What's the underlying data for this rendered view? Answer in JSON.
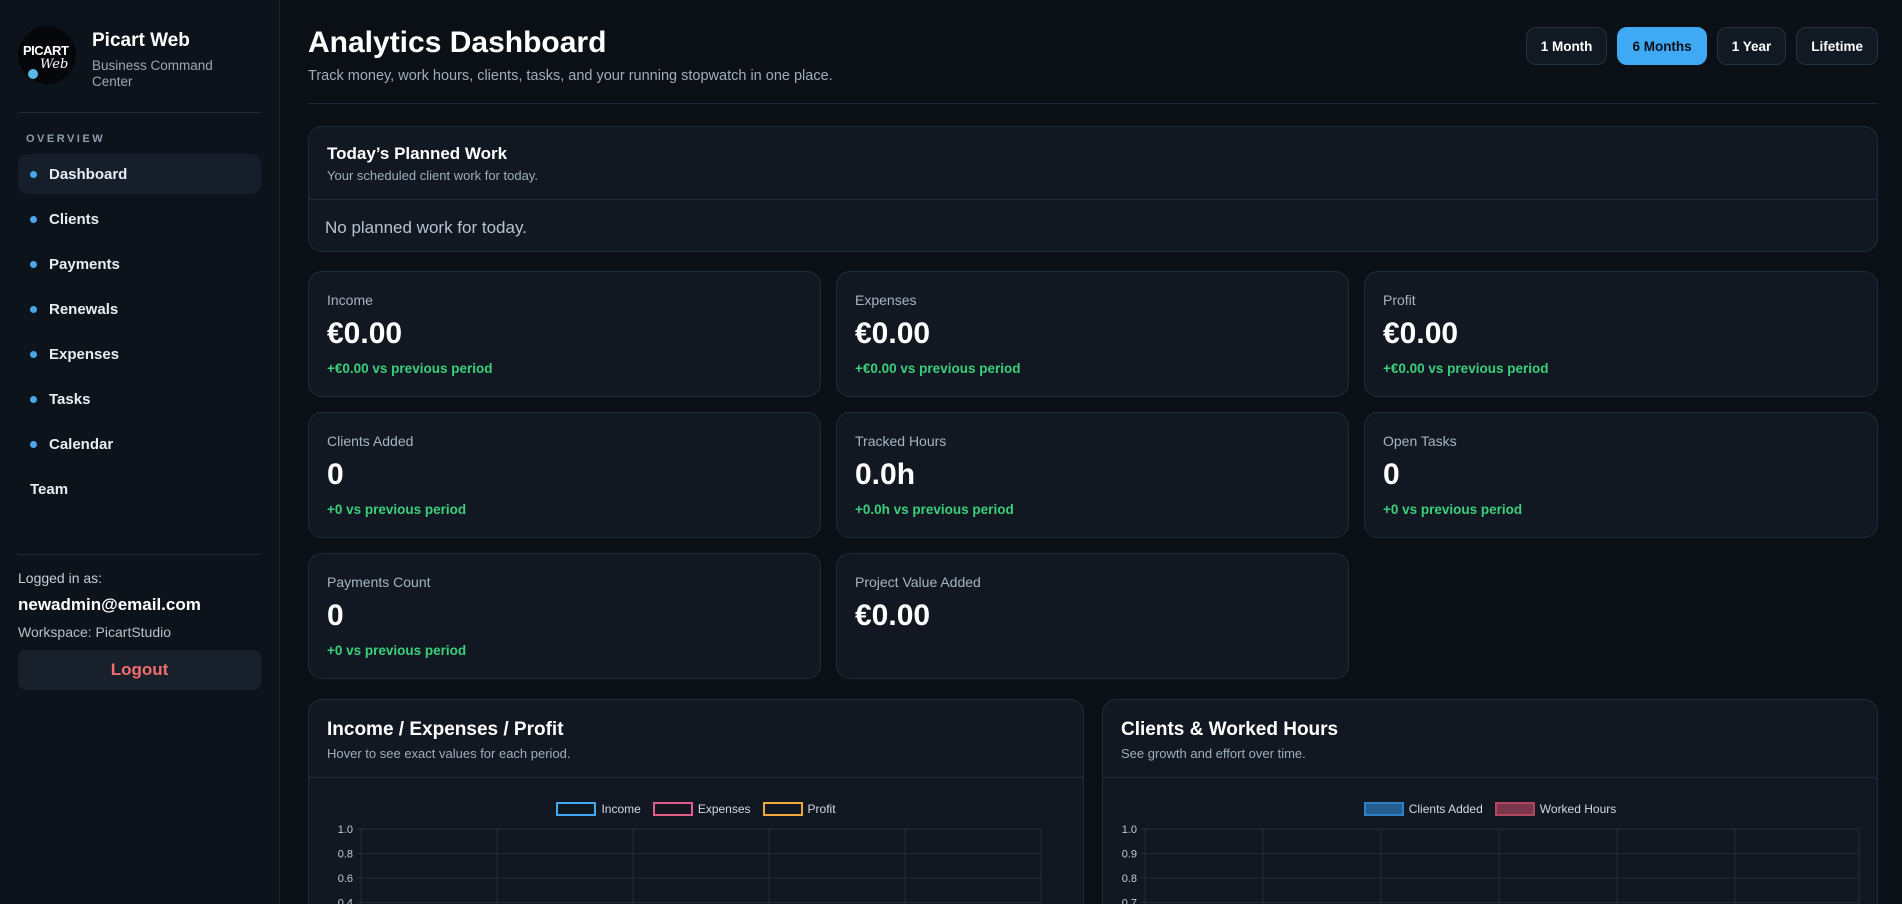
{
  "brand": {
    "name": "Picart Web",
    "subtitle": "Business Command Center",
    "logo_text_1": "PICART",
    "logo_text_2": "Web"
  },
  "sidebar": {
    "section_label": "OVERVIEW",
    "items": [
      {
        "label": "Dashboard",
        "active": true,
        "dot": true
      },
      {
        "label": "Clients",
        "active": false,
        "dot": true
      },
      {
        "label": "Payments",
        "active": false,
        "dot": true
      },
      {
        "label": "Renewals",
        "active": false,
        "dot": true
      },
      {
        "label": "Expenses",
        "active": false,
        "dot": true
      },
      {
        "label": "Tasks",
        "active": false,
        "dot": true
      },
      {
        "label": "Calendar",
        "active": false,
        "dot": true
      },
      {
        "label": "Team",
        "active": false,
        "dot": false
      }
    ],
    "logged_in_label": "Logged in as:",
    "email": "newadmin@email.com",
    "workspace": "Workspace: PicartStudio",
    "logout_label": "Logout"
  },
  "header": {
    "title": "Analytics Dashboard",
    "subtitle": "Track money, work hours, clients, tasks, and your running stopwatch in one place.",
    "ranges": [
      {
        "label": "1 Month",
        "active": false
      },
      {
        "label": "6 Months",
        "active": true
      },
      {
        "label": "1 Year",
        "active": false
      },
      {
        "label": "Lifetime",
        "active": false
      }
    ]
  },
  "planned": {
    "title": "Today’s Planned Work",
    "subtitle": "Your scheduled client work for today.",
    "empty": "No planned work for today."
  },
  "stats": [
    {
      "label": "Income",
      "value": "€0.00",
      "delta": "+€0.00 vs previous period"
    },
    {
      "label": "Expenses",
      "value": "€0.00",
      "delta": "+€0.00 vs previous period"
    },
    {
      "label": "Profit",
      "value": "€0.00",
      "delta": "+€0.00 vs previous period"
    },
    {
      "label": "Clients Added",
      "value": "0",
      "delta": "+0 vs previous period"
    },
    {
      "label": "Tracked Hours",
      "value": "0.0h",
      "delta": "+0.0h vs previous period"
    },
    {
      "label": "Open Tasks",
      "value": "0",
      "delta": "+0 vs previous period"
    },
    {
      "label": "Payments Count",
      "value": "0",
      "delta": "+0 vs previous period"
    },
    {
      "label": "Project Value Added",
      "value": "€0.00",
      "delta": ""
    }
  ],
  "charts": {
    "left": {
      "title": "Income / Expenses / Profit",
      "subtitle": "Hover to see exact values for each period."
    },
    "right": {
      "title": "Clients & Worked Hours",
      "subtitle": "See growth and effort over time."
    }
  },
  "chart_data": [
    {
      "type": "line",
      "series": [
        {
          "name": "Income",
          "color": "#3fa9f5"
        },
        {
          "name": "Expenses",
          "color": "#e35d8a"
        },
        {
          "name": "Profit",
          "color": "#f0a83a"
        }
      ],
      "y_ticks": [
        "1.0",
        "0.8",
        "0.6",
        "0.4"
      ],
      "ylim": [
        0,
        1.0
      ],
      "grid": true,
      "legend": "top-center"
    },
    {
      "type": "bar",
      "series": [
        {
          "name": "Clients Added",
          "color": "#2f7fc4"
        },
        {
          "name": "Worked Hours",
          "color": "#b0465f"
        }
      ],
      "y_ticks": [
        "1.0",
        "0.9",
        "0.8",
        "0.7"
      ],
      "ylim": [
        0,
        1.0
      ],
      "grid": true,
      "legend": "top-center"
    }
  ]
}
